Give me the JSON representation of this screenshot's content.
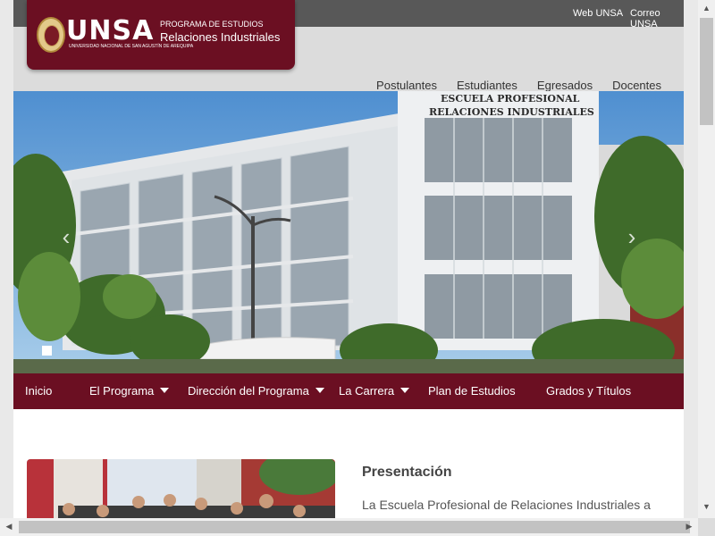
{
  "topbar": {
    "links": [
      "Web UNSA",
      "Correo UNSA"
    ]
  },
  "logo": {
    "brand": "UNSA",
    "brand_subtitle": "UNIVERSIDAD NACIONAL DE SAN AGUSTÍN DE AREQUIPA",
    "program_label": "PROGRAMA DE ESTUDIOS",
    "program_name": "Relaciones Industriales"
  },
  "main_nav": [
    "Postulantes",
    "Estudiantes",
    "Egresados",
    "Docentes"
  ],
  "hero": {
    "building_sign_line1": "ESCUELA PROFESIONAL",
    "building_sign_line2": "RELACIONES INDUSTRIALES"
  },
  "navbar": {
    "items": [
      {
        "label": "Inicio",
        "dropdown": false
      },
      {
        "label": "El Programa",
        "dropdown": true
      },
      {
        "label": "Dirección del Programa",
        "dropdown": true
      },
      {
        "label": "La Carrera",
        "dropdown": true
      },
      {
        "label": "Plan de Estudios",
        "dropdown": false
      },
      {
        "label": "Grados y Títulos",
        "dropdown": false
      }
    ]
  },
  "presentation": {
    "title": "Presentación",
    "text": "La Escuela Profesional de Relaciones Industriales a través del equipo de docentes y con la responsabilidad de"
  },
  "colors": {
    "brand": "#6b0f22",
    "topbar": "#585858",
    "header_bg": "#dcdcdc"
  }
}
